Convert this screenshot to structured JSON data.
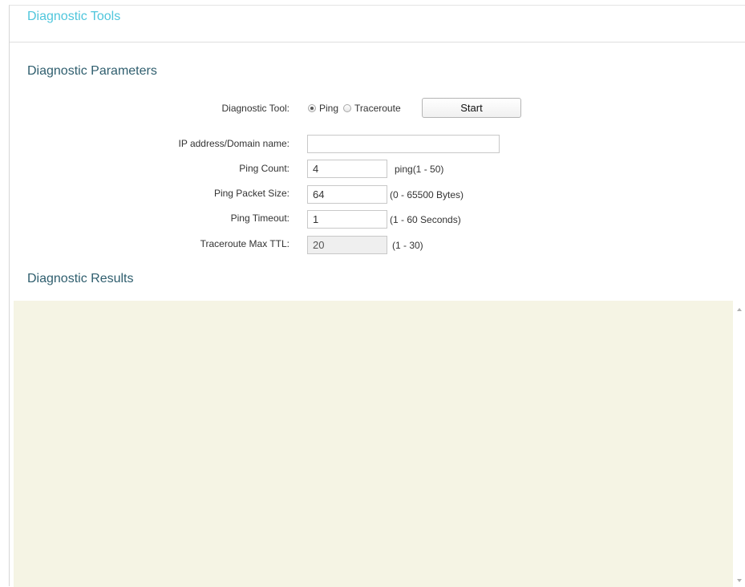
{
  "page": {
    "title": "Diagnostic Tools"
  },
  "parameters": {
    "section_title": "Diagnostic Parameters",
    "tool_label": "Diagnostic Tool:",
    "tool_options": [
      {
        "label": "Ping",
        "selected": true
      },
      {
        "label": "Traceroute",
        "selected": false
      }
    ],
    "start_label": "Start",
    "ip_label": "IP address/Domain name:",
    "ip_value": "",
    "ping_count_label": "Ping Count:",
    "ping_count_value": "4",
    "ping_count_hint": "ping(1 - 50)",
    "packet_size_label": "Ping Packet Size:",
    "packet_size_value": "64",
    "packet_size_hint": "(0 - 65500 Bytes)",
    "timeout_label": "Ping Timeout:",
    "timeout_value": "1",
    "timeout_hint": "(1 - 60 Seconds)",
    "ttl_label": "Traceroute Max TTL:",
    "ttl_value": "20",
    "ttl_hint": "(1 - 30)"
  },
  "results": {
    "section_title": "Diagnostic Results",
    "content": ""
  },
  "colors": {
    "title": "#4fc6dc",
    "section": "#2f5e6e",
    "results_bg": "#f5f4e4"
  }
}
